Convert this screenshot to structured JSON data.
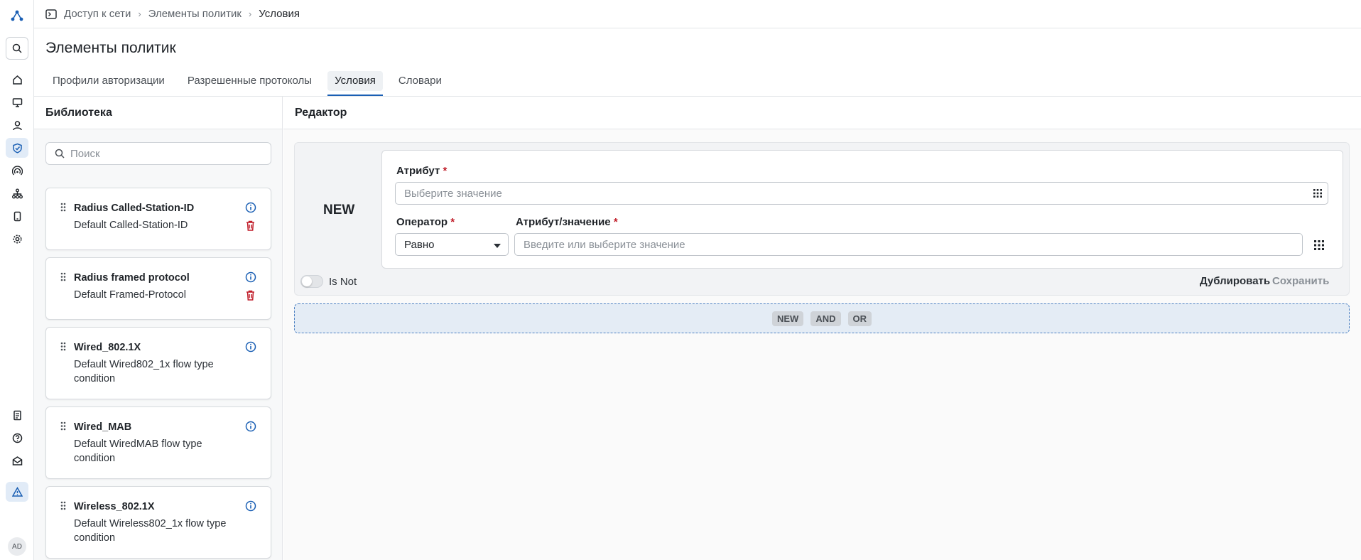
{
  "breadcrumb": [
    "Доступ к сети",
    "Элементы политик",
    "Условия"
  ],
  "page_title": "Элементы политик",
  "tabs": [
    {
      "label": "Профили авторизации",
      "active": false
    },
    {
      "label": "Разрешенные протоколы",
      "active": false
    },
    {
      "label": "Условия",
      "active": true
    },
    {
      "label": "Словари",
      "active": false
    }
  ],
  "library": {
    "title": "Библиотека",
    "search_placeholder": "Поиск",
    "items": [
      {
        "title": "Radius Called-Station-ID",
        "desc": "Default Called-Station-ID",
        "deletable": true
      },
      {
        "title": "Radius framed protocol",
        "desc": "Default Framed-Protocol",
        "deletable": true
      },
      {
        "title": "Wired_802.1X",
        "desc": "Default Wired802_1x flow type condition",
        "deletable": false
      },
      {
        "title": "Wired_MAB",
        "desc": "Default WiredMAB flow type condition",
        "deletable": false
      },
      {
        "title": "Wireless_802.1X",
        "desc": "Default Wireless802_1x flow type condition",
        "deletable": false
      }
    ]
  },
  "editor": {
    "title": "Редактор",
    "block_label": "NEW",
    "attribute_label": "Атрибут",
    "attribute_placeholder": "Выберите значение",
    "operator_label": "Оператор",
    "operator_value": "Равно",
    "value_label": "Атрибут/значение",
    "value_placeholder": "Введите или выберите значение",
    "required_mark": "*",
    "is_not_label": "Is Not",
    "duplicate_label": "Дублировать",
    "save_label": "Сохранить",
    "chips": [
      "NEW",
      "AND",
      "OR"
    ]
  },
  "user": {
    "initials": "AD"
  },
  "colors": {
    "accent": "#1a5fb4",
    "danger": "#c01c28",
    "active_bg": "#e1ebf7"
  }
}
